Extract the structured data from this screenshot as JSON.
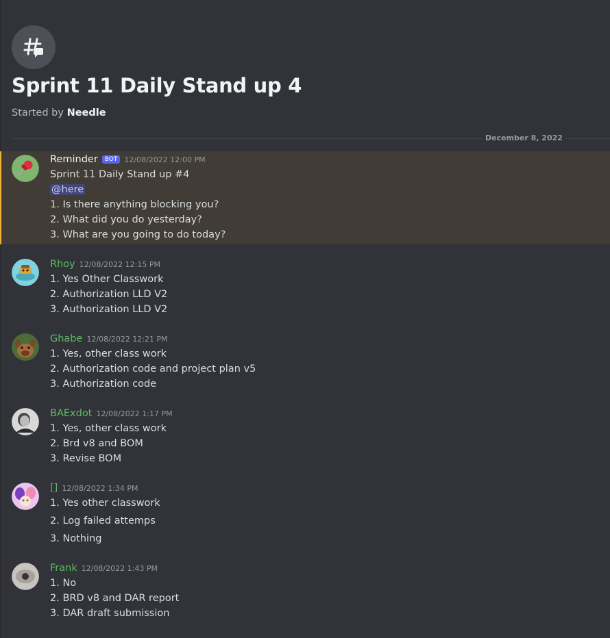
{
  "thread": {
    "title": "Sprint 11 Daily Stand up 4",
    "started_by_prefix": "Started by ",
    "started_by_name": "Needle",
    "date_divider": "December 8, 2022"
  },
  "colors": {
    "background": "#313338",
    "member_green": "#5dba63",
    "mention_bar": "#f0b232",
    "bot_tag": "#5865f2"
  },
  "messages": [
    {
      "author": "Reminder",
      "bot_tag": "BOT",
      "timestamp": "12/08/2022 12:00 PM",
      "mention": "@here",
      "lines": [
        "Sprint 11 Daily Stand up #4",
        "1. Is there anything blocking you?",
        "2. What did you do yesterday?",
        "3. What are you going to do today?"
      ]
    },
    {
      "author": "Rhoy",
      "timestamp": "12/08/2022 12:15 PM",
      "lines": [
        "1. Yes Other Classwork",
        "2. Authorization LLD V2",
        "3. Authorization LLD V2"
      ]
    },
    {
      "author": "Ghabe",
      "timestamp": "12/08/2022 12:21 PM",
      "lines": [
        "1. Yes, other class work",
        "2. Authorization code and project plan v5",
        "3. Authorization code"
      ]
    },
    {
      "author": "BAExdot",
      "timestamp": "12/08/2022 1:17 PM",
      "lines": [
        "1. Yes, other class work",
        "2. Brd v8 and BOM",
        "3. Revise BOM"
      ]
    },
    {
      "author": "[]",
      "timestamp": "12/08/2022 1:34 PM",
      "lines": [
        "1. Yes other classwork",
        "2. Log failed attemps",
        "3. Nothing"
      ]
    },
    {
      "author": "Frank",
      "timestamp": "12/08/2022 1:43 PM",
      "lines": [
        "1. No",
        "2. BRD v8 and DAR report",
        "3. DAR draft submission"
      ]
    }
  ]
}
